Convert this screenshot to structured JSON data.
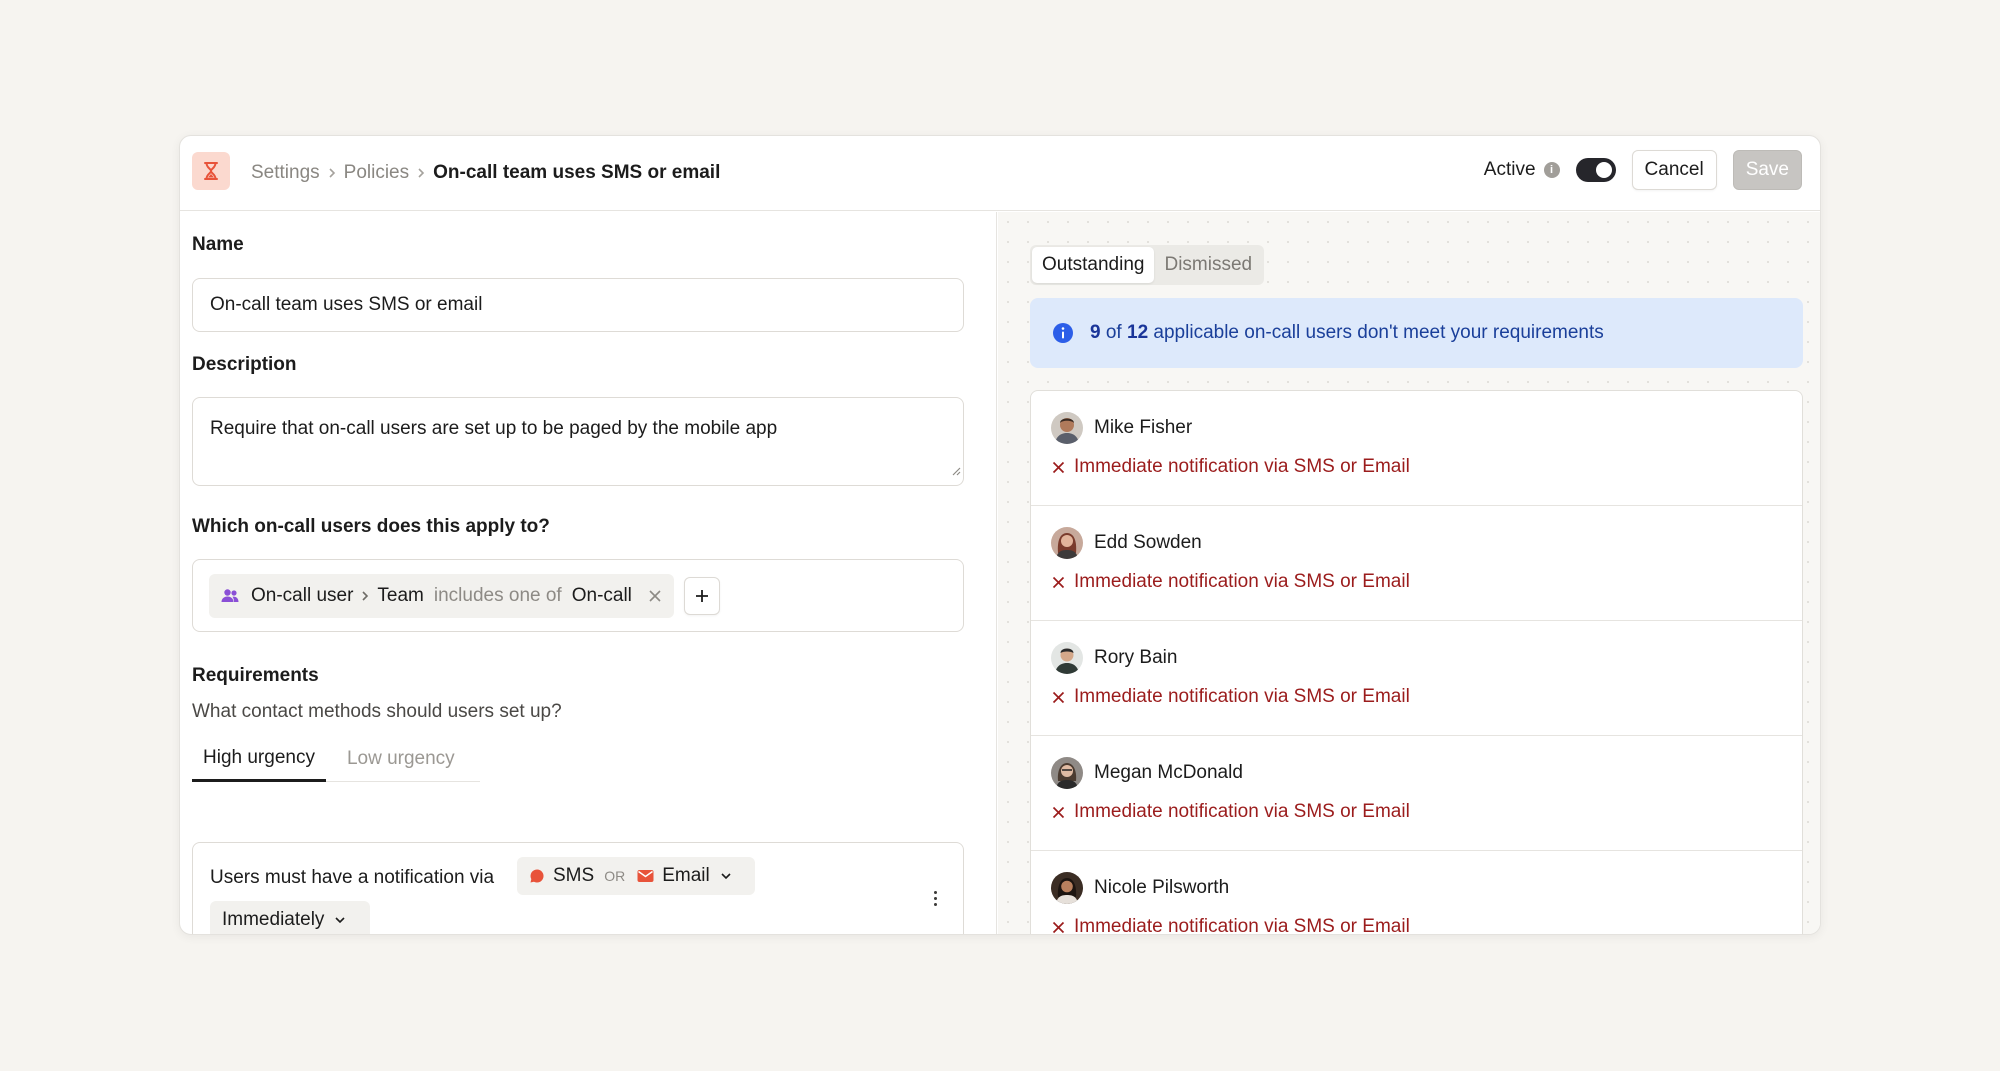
{
  "header": {
    "breadcrumb": [
      "Settings",
      "Policies"
    ],
    "current": "On-call team uses SMS or email",
    "active_label": "Active",
    "active_on": true,
    "cancel_label": "Cancel",
    "save_label": "Save"
  },
  "form": {
    "name_label": "Name",
    "name_value": "On-call team uses SMS or email",
    "description_label": "Description",
    "description_value": "Require that on-call users are set up to be paged by the mobile app",
    "applies_label": "Which on-call users does this apply to?",
    "condition": {
      "subject": "On-call user",
      "field": "Team",
      "operator": "includes one of",
      "value": "On-call"
    },
    "requirements_label": "Requirements",
    "requirements_sub": "What contact methods should users set up?",
    "tabs": [
      "High urgency",
      "Low urgency"
    ],
    "rule": {
      "text": "Users must have a notification via",
      "method_a": "SMS",
      "joiner": "OR",
      "method_b": "Email",
      "timing": "Immediately"
    }
  },
  "results": {
    "tabs": [
      "Outstanding",
      "Dismissed"
    ],
    "banner": {
      "count": "9",
      "of": "of",
      "total": "12",
      "rest": "applicable on-call users don't meet your requirements"
    },
    "users": [
      {
        "name": "Mike Fisher",
        "issue": "Immediate notification via SMS or Email"
      },
      {
        "name": "Edd Sowden",
        "issue": "Immediate notification via SMS or Email"
      },
      {
        "name": "Rory Bain",
        "issue": "Immediate notification via SMS or Email"
      },
      {
        "name": "Megan McDonald",
        "issue": "Immediate notification via SMS or Email"
      },
      {
        "name": "Nicole Pilsworth",
        "issue": "Immediate notification via SMS or Email"
      }
    ]
  },
  "colors": {
    "accent_orange": "#e8533a",
    "error_red": "#9b1c1c",
    "info_blue": "#2c5ee8",
    "banner_bg": "#dde9fb"
  },
  "icons": {
    "app": "hourglass-icon",
    "condition": "users-icon",
    "sms": "chat-bubble-icon",
    "email": "envelope-icon",
    "violation": "close-icon",
    "banner": "info-icon"
  }
}
